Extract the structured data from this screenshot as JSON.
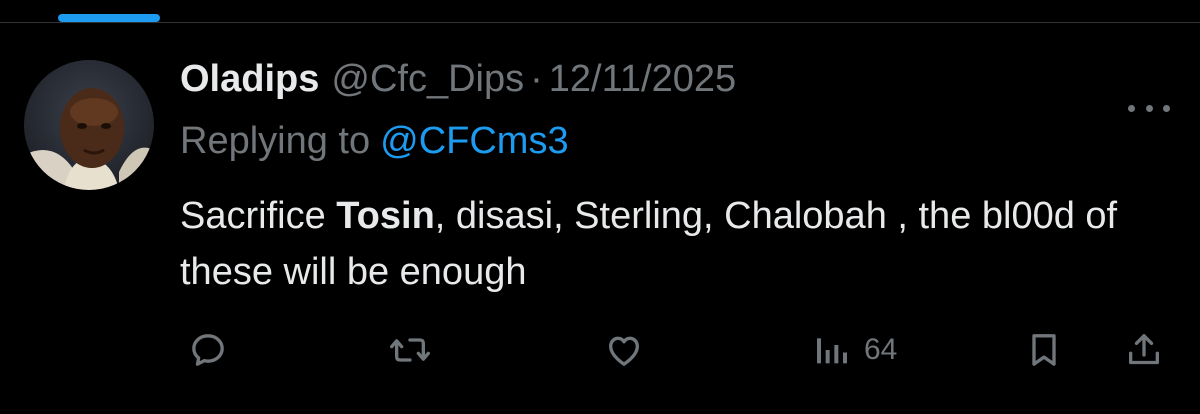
{
  "tabs": {
    "active_indicator_color": "#1d9bf0"
  },
  "tweet": {
    "author": {
      "display_name": "Oladips",
      "handle": "@Cfc_Dips",
      "avatar_alt": "profile photo"
    },
    "separator": "·",
    "date": "12/11/2025",
    "reply": {
      "prefix": "Replying to",
      "mention": "@CFCms3"
    },
    "text": {
      "part1": "Sacrifice ",
      "bold": "Tosin",
      "part2": ", disasi, Sterling, Chalobah , the bl00d of these will be enough"
    },
    "actions": {
      "reply_icon": "speech-bubble-icon",
      "retweet_icon": "retweet-icon",
      "like_icon": "heart-icon",
      "views_icon": "bar-chart-icon",
      "views_count": "64",
      "bookmark_icon": "bookmark-icon",
      "share_icon": "share-icon"
    }
  },
  "colors": {
    "background": "#000000",
    "text_primary": "#e7e9ea",
    "text_secondary": "#71767b",
    "link": "#1d9bf0",
    "divider": "#2f3336"
  }
}
